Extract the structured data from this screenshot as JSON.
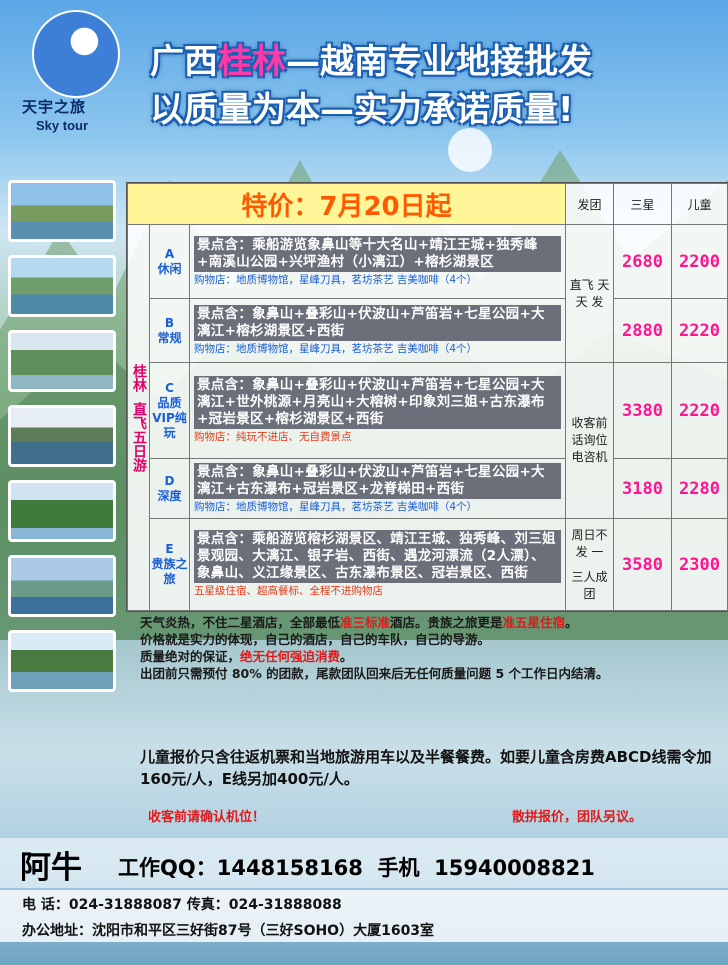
{
  "brand": {
    "name_cn": "天宇之旅",
    "name_en": "Sky tour"
  },
  "headline": {
    "line1_a": "广西",
    "line1_b": "桂林",
    "line1_c": "—越南专业地接批发",
    "line2": "以质量为本—实力承诺质量!"
  },
  "table": {
    "title_a": "特价：",
    "title_b": "7月20日起",
    "col_depart": "发团",
    "col_three_star": "三星",
    "col_child": "儿童",
    "sidebar_route": "桂林",
    "sidebar_flight": "直飞五日游",
    "routes": [
      {
        "code": "A",
        "type": "休闲",
        "sights": "景点含：乘船游览象鼻山等十大名山+靖江王城+独秀峰+南溪山公园+兴坪渔村（小漓江）+榕杉湖景区",
        "shop": "购物店：地质博物馆，星峰刀具，茗坊茶艺  吉美咖啡（4个）",
        "price": "2680",
        "child_price": "2200"
      },
      {
        "code": "B",
        "type": "常规",
        "sights": "景点含：象鼻山+叠彩山+伏波山+芦笛岩+七星公园+大漓江+榕杉湖景区+西街",
        "shop": "购物店：地质博物馆，星峰刀具，茗坊茶艺  吉美咖啡（4个）",
        "price": "2880",
        "child_price": "2220"
      },
      {
        "code": "C",
        "type": "品质VIP纯玩",
        "sights": "景点含：象鼻山+叠彩山+伏波山+芦笛岩+七星公园+大漓江+世外桃源+月亮山+大榕树+印象刘三姐+古东瀑布+冠岩景区+榕杉湖景区+西街",
        "shop": "购物店：纯玩不进店、无自费景点",
        "price": "3380",
        "child_price": "2220"
      },
      {
        "code": "D",
        "type": "深度",
        "sights": "景点含：象鼻山+叠彩山+伏波山+芦笛岩+七星公园+大漓江+古东瀑布+冠岩景区+龙脊梯田+西街",
        "shop": "购物店：地质博物馆，星峰刀具，茗坊茶艺  吉美咖啡（4个）",
        "price": "3180",
        "child_price": "2280"
      },
      {
        "code": "E",
        "type": "贵族之旅",
        "sights": "景点含：乘船游览榕杉湖景区、靖江王城、独秀峰、刘三姐景观园、大漓江、银子岩、西街、遇龙河漂流（2人漂）、象鼻山、义江缘景区、古东瀑布景区、冠岩景区、西街",
        "shop": "五星级住宿、超高餐标、全程不进购物店",
        "price": "3580",
        "child_price": "2300"
      }
    ],
    "depart_notes": [
      "直飞 天天 发",
      "收客前话询位 电咨机",
      "周日不发 一",
      "三人成团"
    ]
  },
  "notes": {
    "line1_a": "天气炎热，不住二星酒店，全部最低",
    "line1_b": "准三标准",
    "line1_c": "酒店。贵族之旅更是",
    "line1_d": "准五星住宿",
    "line1_e": "。",
    "line2": "价格就是实力的体现，自己的酒店，自己的车队，自己的导游。",
    "line3_a": "质量绝对的保证，",
    "line3_b": "绝无任何强迫消费",
    "line3_c": "。",
    "line4": "出团前只需预付 80% 的团款，尾款团队回来后无任何质量问题 5 个工作日内结清。"
  },
  "child_note": "儿童报价只含往返机票和当地旅游用车以及半餐餐费。如要儿童含房费ABCD线需令加160元/人，E线另加400元/人。",
  "confirm_note": "收客前请确认机位！",
  "bulk_note": "散拼报价，团队另议。",
  "contact": {
    "name": "阿牛",
    "qq_label": "工作QQ：",
    "qq": "1448158168",
    "mobile_label": "手机",
    "mobile": "15940008821",
    "phone_label": "电      话：",
    "phone": "024-31888087",
    "fax_label": "传真：",
    "fax": "024-31888088",
    "address_label": "办公地址：",
    "address": "沈阳市和平区三好街87号（三好SOHO）大厦1603室"
  }
}
